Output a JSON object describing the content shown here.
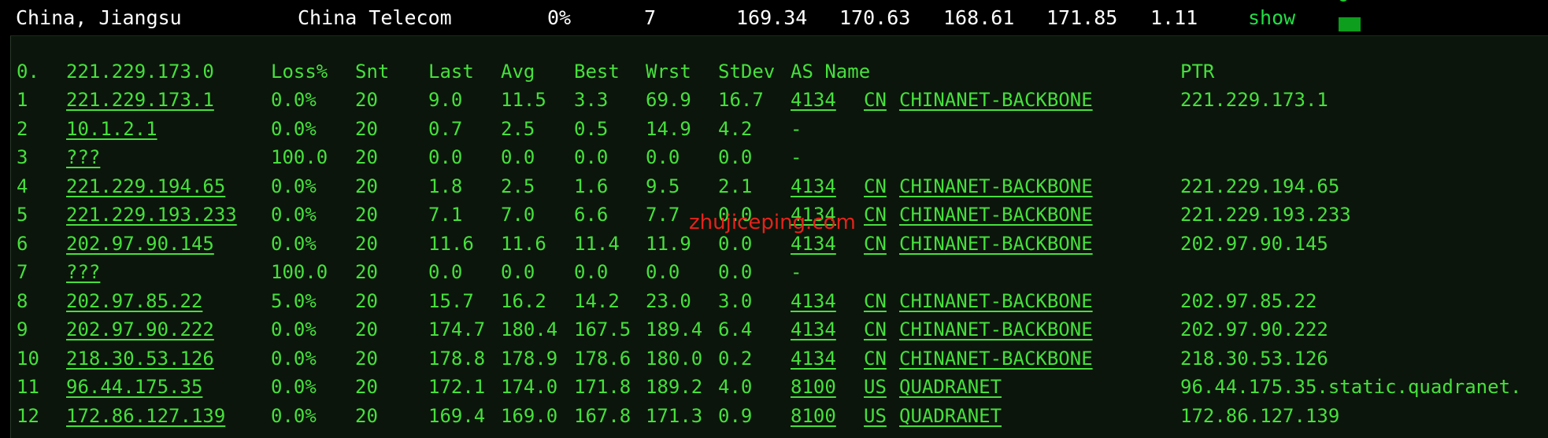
{
  "summary": {
    "location": "China, Jiangsu",
    "isp": "China Telecom",
    "loss": "0%",
    "hops": "7",
    "v1": "169.34",
    "v2": "170.63",
    "v3": "168.61",
    "v4": "171.85",
    "v5": "1.11",
    "show": "show"
  },
  "header": {
    "idx": "0.",
    "host": "221.229.173.0",
    "loss": "Loss%",
    "snt": "Snt",
    "last": "Last",
    "avg": "Avg",
    "best": "Best",
    "wrst": "Wrst",
    "stdev": "StDev",
    "asname": "AS Name",
    "ptr": "PTR"
  },
  "rows": [
    {
      "idx": "1",
      "host": "221.229.173.1",
      "loss": "0.0%",
      "snt": "20",
      "last": "9.0",
      "avg": "11.5",
      "best": "3.3",
      "wrst": "69.9",
      "stdev": "16.7",
      "asn": "4134",
      "cc": "CN",
      "as": "CHINANET-BACKBONE",
      "ptr": "221.229.173.1"
    },
    {
      "idx": "2",
      "host": "10.1.2.1",
      "loss": "0.0%",
      "snt": "20",
      "last": "0.7",
      "avg": "2.5",
      "best": "0.5",
      "wrst": "14.9",
      "stdev": "4.2",
      "asn": "-",
      "cc": "",
      "as": "",
      "ptr": ""
    },
    {
      "idx": "3",
      "host": "???",
      "loss": "100.0",
      "snt": "20",
      "last": "0.0",
      "avg": "0.0",
      "best": "0.0",
      "wrst": "0.0",
      "stdev": "0.0",
      "asn": "-",
      "cc": "",
      "as": "",
      "ptr": ""
    },
    {
      "idx": "4",
      "host": "221.229.194.65",
      "loss": "0.0%",
      "snt": "20",
      "last": "1.8",
      "avg": "2.5",
      "best": "1.6",
      "wrst": "9.5",
      "stdev": "2.1",
      "asn": "4134",
      "cc": "CN",
      "as": "CHINANET-BACKBONE",
      "ptr": "221.229.194.65"
    },
    {
      "idx": "5",
      "host": "221.229.193.233",
      "loss": "0.0%",
      "snt": "20",
      "last": "7.1",
      "avg": "7.0",
      "best": "6.6",
      "wrst": "7.7",
      "stdev": "0.0",
      "asn": "4134",
      "cc": "CN",
      "as": "CHINANET-BACKBONE",
      "ptr": "221.229.193.233"
    },
    {
      "idx": "6",
      "host": "202.97.90.145",
      "loss": "0.0%",
      "snt": "20",
      "last": "11.6",
      "avg": "11.6",
      "best": "11.4",
      "wrst": "11.9",
      "stdev": "0.0",
      "asn": "4134",
      "cc": "CN",
      "as": "CHINANET-BACKBONE",
      "ptr": "202.97.90.145"
    },
    {
      "idx": "7",
      "host": "???",
      "loss": "100.0",
      "snt": "20",
      "last": "0.0",
      "avg": "0.0",
      "best": "0.0",
      "wrst": "0.0",
      "stdev": "0.0",
      "asn": "-",
      "cc": "",
      "as": "",
      "ptr": ""
    },
    {
      "idx": "8",
      "host": "202.97.85.22",
      "loss": "5.0%",
      "snt": "20",
      "last": "15.7",
      "avg": "16.2",
      "best": "14.2",
      "wrst": "23.0",
      "stdev": "3.0",
      "asn": "4134",
      "cc": "CN",
      "as": "CHINANET-BACKBONE",
      "ptr": "202.97.85.22"
    },
    {
      "idx": "9",
      "host": "202.97.90.222",
      "loss": "0.0%",
      "snt": "20",
      "last": "174.7",
      "avg": "180.4",
      "best": "167.5",
      "wrst": "189.4",
      "stdev": "6.4",
      "asn": "4134",
      "cc": "CN",
      "as": "CHINANET-BACKBONE",
      "ptr": "202.97.90.222"
    },
    {
      "idx": "10",
      "host": "218.30.53.126",
      "loss": "0.0%",
      "snt": "20",
      "last": "178.8",
      "avg": "178.9",
      "best": "178.6",
      "wrst": "180.0",
      "stdev": "0.2",
      "asn": "4134",
      "cc": "CN",
      "as": "CHINANET-BACKBONE",
      "ptr": "218.30.53.126"
    },
    {
      "idx": "11",
      "host": "96.44.175.35",
      "loss": "0.0%",
      "snt": "20",
      "last": "172.1",
      "avg": "174.0",
      "best": "171.8",
      "wrst": "189.2",
      "stdev": "4.0",
      "asn": "8100",
      "cc": "US",
      "as": "QUADRANET",
      "ptr": "96.44.175.35.static.quadranet."
    },
    {
      "idx": "12",
      "host": "172.86.127.139",
      "loss": "0.0%",
      "snt": "20",
      "last": "169.4",
      "avg": "169.0",
      "best": "167.8",
      "wrst": "171.3",
      "stdev": "0.9",
      "asn": "8100",
      "cc": "US",
      "as": "QUADRANET",
      "ptr": "172.86.127.139"
    }
  ],
  "watermark": "zhujiceping.com",
  "colors": {
    "background": "#000000",
    "panel": "#0b150b",
    "terminal_text": "#46e03c",
    "summary_text": "#ffffff",
    "show_link": "#22dd44",
    "watermark": "#e5231b"
  }
}
